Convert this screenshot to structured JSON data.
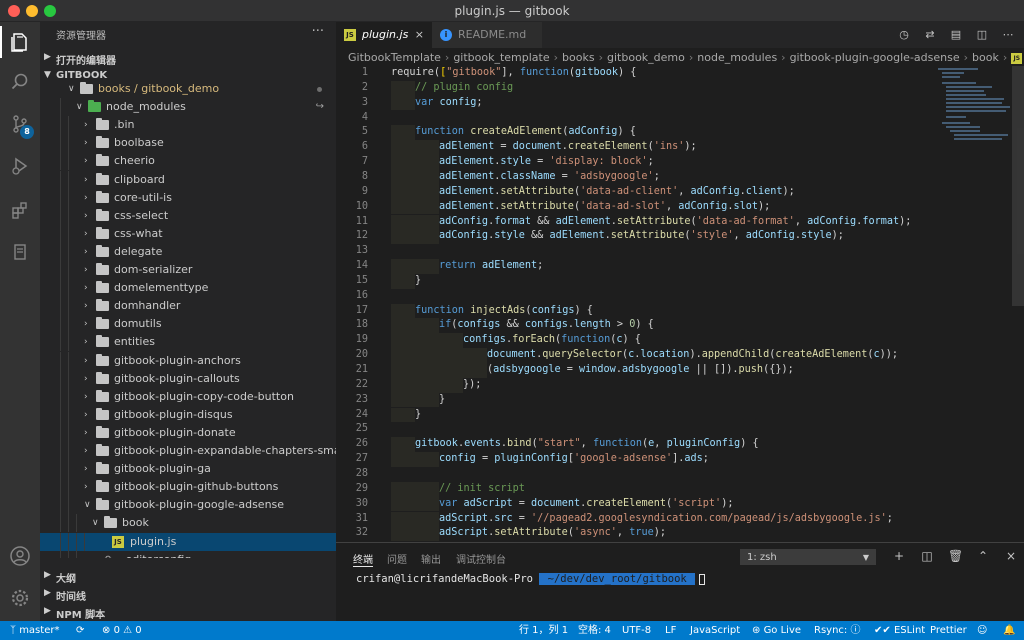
{
  "window": {
    "title": "plugin.js — gitbook"
  },
  "activity": {
    "scm_badge": "8"
  },
  "sidebar": {
    "header": "资源管理器",
    "more": "···",
    "open_editors": "打开的编辑器",
    "workspace": "GITBOOK",
    "tree": [
      {
        "label": "books / gitbook_demo",
        "type": "folder",
        "open": true,
        "depth": 2,
        "modified": true
      },
      {
        "label": "node_modules",
        "type": "folder-green",
        "open": true,
        "depth": 3,
        "link": true
      },
      {
        "label": ".bin",
        "type": "folder",
        "depth": 4
      },
      {
        "label": "boolbase",
        "type": "folder",
        "depth": 4
      },
      {
        "label": "cheerio",
        "type": "folder",
        "depth": 4
      },
      {
        "label": "clipboard",
        "type": "folder",
        "depth": 4
      },
      {
        "label": "core-util-is",
        "type": "folder",
        "depth": 4
      },
      {
        "label": "css-select",
        "type": "folder",
        "depth": 4
      },
      {
        "label": "css-what",
        "type": "folder",
        "depth": 4
      },
      {
        "label": "delegate",
        "type": "folder",
        "depth": 4
      },
      {
        "label": "dom-serializer",
        "type": "folder",
        "depth": 4
      },
      {
        "label": "domelementtype",
        "type": "folder",
        "depth": 4
      },
      {
        "label": "domhandler",
        "type": "folder",
        "depth": 4
      },
      {
        "label": "domutils",
        "type": "folder",
        "depth": 4
      },
      {
        "label": "entities",
        "type": "folder",
        "depth": 4
      },
      {
        "label": "gitbook-plugin-anchors",
        "type": "folder",
        "depth": 4
      },
      {
        "label": "gitbook-plugin-callouts",
        "type": "folder",
        "depth": 4
      },
      {
        "label": "gitbook-plugin-copy-code-button",
        "type": "folder",
        "depth": 4
      },
      {
        "label": "gitbook-plugin-disqus",
        "type": "folder",
        "depth": 4
      },
      {
        "label": "gitbook-plugin-donate",
        "type": "folder",
        "depth": 4
      },
      {
        "label": "gitbook-plugin-expandable-chapters-small",
        "type": "folder",
        "depth": 4
      },
      {
        "label": "gitbook-plugin-ga",
        "type": "folder",
        "depth": 4
      },
      {
        "label": "gitbook-plugin-github-buttons",
        "type": "folder",
        "depth": 4
      },
      {
        "label": "gitbook-plugin-google-adsense",
        "type": "folder",
        "open": true,
        "depth": 4
      },
      {
        "label": "book",
        "type": "folder",
        "open": true,
        "depth": 5
      },
      {
        "label": "plugin.js",
        "type": "js",
        "depth": 6,
        "selected": true
      },
      {
        "label": ".editorconfig",
        "type": "gear",
        "depth": 5
      }
    ],
    "outline": "大纲",
    "timeline": "时间线",
    "npm_scripts": "NPM 脚本"
  },
  "editor": {
    "tabs": [
      {
        "label": "plugin.js",
        "active": true,
        "close": "×"
      },
      {
        "label": "README.md",
        "active": false
      }
    ],
    "breadcrumb": [
      "GitbookTemplate",
      "gitbook_template",
      "books",
      "gitbook_demo",
      "node_modules",
      "gitbook-plugin-google-adsense",
      "book",
      "plugin.js"
    ],
    "lines": [
      {
        "n": "1",
        "html": "<span class='p'>require(</span><span class='b'>[</span><span class='s'>\"gitbook\"</span><span class='p'>], </span><span class='k'>function</span><span class='p'>(</span><span class='v'>gitbook</span><span class='p'>) {</span>"
      },
      {
        "n": "2",
        "indent": 1,
        "html": "<span class='c'>// plugin config</span>"
      },
      {
        "n": "3",
        "indent": 1,
        "html": "<span class='k'>var</span><span class='p'> </span><span class='v'>config</span><span class='p'>;</span>"
      },
      {
        "n": "4",
        "html": ""
      },
      {
        "n": "5",
        "indent": 1,
        "html": "<span class='k'>function</span><span class='p'> </span><span class='f'>createAdElement</span><span class='p'>(</span><span class='v'>adConfig</span><span class='p'>) {</span>"
      },
      {
        "n": "6",
        "indent": 2,
        "html": "<span class='v'>adElement</span><span class='p'> = </span><span class='v'>document</span><span class='p'>.</span><span class='f'>createElement</span><span class='p'>(</span><span class='s'>'ins'</span><span class='p'>);</span>"
      },
      {
        "n": "7",
        "indent": 2,
        "html": "<span class='v'>adElement</span><span class='p'>.</span><span class='v'>style</span><span class='p'> = </span><span class='s'>'display: block'</span><span class='p'>;</span>"
      },
      {
        "n": "8",
        "indent": 2,
        "html": "<span class='v'>adElement</span><span class='p'>.</span><span class='v'>className</span><span class='p'> = </span><span class='s'>'adsbygoogle'</span><span class='p'>;</span>"
      },
      {
        "n": "9",
        "indent": 2,
        "html": "<span class='v'>adElement</span><span class='p'>.</span><span class='f'>setAttribute</span><span class='p'>(</span><span class='s'>'data-ad-client'</span><span class='p'>, </span><span class='v'>adConfig</span><span class='p'>.</span><span class='v'>client</span><span class='p'>);</span>"
      },
      {
        "n": "10",
        "indent": 2,
        "html": "<span class='v'>adElement</span><span class='p'>.</span><span class='f'>setAttribute</span><span class='p'>(</span><span class='s'>'data-ad-slot'</span><span class='p'>, </span><span class='v'>adConfig</span><span class='p'>.</span><span class='v'>slot</span><span class='p'>);</span>"
      },
      {
        "n": "11",
        "indent": 2,
        "html": "<span class='v'>adConfig</span><span class='p'>.</span><span class='v'>format</span><span class='p'> &amp;&amp; </span><span class='v'>adElement</span><span class='p'>.</span><span class='f'>setAttribute</span><span class='p'>(</span><span class='s'>'data-ad-format'</span><span class='p'>, </span><span class='v'>adConfig</span><span class='p'>.</span><span class='v'>format</span><span class='p'>);</span>"
      },
      {
        "n": "12",
        "indent": 2,
        "html": "<span class='v'>adConfig</span><span class='p'>.</span><span class='v'>style</span><span class='p'> &amp;&amp; </span><span class='v'>adElement</span><span class='p'>.</span><span class='f'>setAttribute</span><span class='p'>(</span><span class='s'>'style'</span><span class='p'>, </span><span class='v'>adConfig</span><span class='p'>.</span><span class='v'>style</span><span class='p'>);</span>"
      },
      {
        "n": "13",
        "html": ""
      },
      {
        "n": "14",
        "indent": 2,
        "html": "<span class='k'>return</span><span class='p'> </span><span class='v'>adElement</span><span class='p'>;</span>"
      },
      {
        "n": "15",
        "indent": 1,
        "html": "<span class='p'>}</span>"
      },
      {
        "n": "16",
        "html": ""
      },
      {
        "n": "17",
        "indent": 1,
        "html": "<span class='k'>function</span><span class='p'> </span><span class='f'>injectAds</span><span class='p'>(</span><span class='v'>configs</span><span class='p'>) {</span>"
      },
      {
        "n": "18",
        "indent": 2,
        "html": "<span class='k'>if</span><span class='p'>(</span><span class='v'>configs</span><span class='p'> &amp;&amp; </span><span class='v'>configs</span><span class='p'>.</span><span class='v'>length</span><span class='p'> &gt; </span><span class='n'>0</span><span class='p'>) {</span>"
      },
      {
        "n": "19",
        "indent": 3,
        "html": "<span class='v'>configs</span><span class='p'>.</span><span class='f'>forEach</span><span class='p'>(</span><span class='k'>function</span><span class='p'>(</span><span class='v'>c</span><span class='p'>) {</span>"
      },
      {
        "n": "20",
        "indent": 4,
        "html": "<span class='v'>document</span><span class='p'>.</span><span class='f'>querySelector</span><span class='p'>(</span><span class='v'>c</span><span class='p'>.</span><span class='v'>location</span><span class='p'>).</span><span class='f'>appendChild</span><span class='p'>(</span><span class='f'>createAdElement</span><span class='p'>(</span><span class='v'>c</span><span class='p'>));</span>"
      },
      {
        "n": "21",
        "indent": 4,
        "html": "<span class='p'>(</span><span class='v'>adsbygoogle</span><span class='p'> = </span><span class='v'>window</span><span class='p'>.</span><span class='v'>adsbygoogle</span><span class='p'> || []).</span><span class='f'>push</span><span class='p'>({});</span>"
      },
      {
        "n": "22",
        "indent": 3,
        "html": "<span class='p'>});</span>"
      },
      {
        "n": "23",
        "indent": 2,
        "html": "<span class='p'>}</span>"
      },
      {
        "n": "24",
        "indent": 1,
        "html": "<span class='p'>}</span>"
      },
      {
        "n": "25",
        "html": ""
      },
      {
        "n": "26",
        "indent": 1,
        "html": "<span class='v'>gitbook</span><span class='p'>.</span><span class='v'>events</span><span class='p'>.</span><span class='f'>bind</span><span class='p'>(</span><span class='s'>\"start\"</span><span class='p'>, </span><span class='k'>function</span><span class='p'>(</span><span class='v'>e</span><span class='p'>, </span><span class='v'>pluginConfig</span><span class='p'>) {</span>"
      },
      {
        "n": "27",
        "indent": 2,
        "html": "<span class='v'>config</span><span class='p'> = </span><span class='v'>pluginConfig</span><span class='p'>[</span><span class='s'>'google-adsense'</span><span class='p'>].</span><span class='v'>ads</span><span class='p'>;</span>"
      },
      {
        "n": "28",
        "html": ""
      },
      {
        "n": "29",
        "indent": 2,
        "html": "<span class='c'>// init script</span>"
      },
      {
        "n": "30",
        "indent": 2,
        "html": "<span class='k'>var</span><span class='p'> </span><span class='v'>adScript</span><span class='p'> = </span><span class='v'>document</span><span class='p'>.</span><span class='f'>createElement</span><span class='p'>(</span><span class='s'>'script'</span><span class='p'>);</span>"
      },
      {
        "n": "31",
        "indent": 2,
        "html": "<span class='v'>adScript</span><span class='p'>.</span><span class='v'>src</span><span class='p'> = </span><span class='s'>'//pagead2.googlesyndication.com/pagead/js/adsbygoogle.js'</span><span class='p'>;</span>"
      },
      {
        "n": "32",
        "indent": 2,
        "html": "<span class='v'>adScript</span><span class='p'>.</span><span class='f'>setAttribute</span><span class='p'>(</span><span class='s'>'async'</span><span class='p'>, </span><span class='k'>true</span><span class='p'>);</span>"
      }
    ]
  },
  "panel": {
    "tabs": [
      "终端",
      "问题",
      "输出",
      "调试控制台"
    ],
    "terminal_select": "1: zsh",
    "prompt": "crifan@licrifandeMacBook-Pro",
    "path": " ~/dev/dev_root/gitbook "
  },
  "statusbar": {
    "branch": "master*",
    "errors": "0",
    "warnings": "0",
    "position": "行 1，列 1",
    "spaces": "空格: 4",
    "encoding": "UTF-8",
    "eol": "LF",
    "language": "JavaScript",
    "golive": "Go Live",
    "rsync": "Rsync:",
    "eslint": "ESLint",
    "prettier": "Prettier"
  }
}
